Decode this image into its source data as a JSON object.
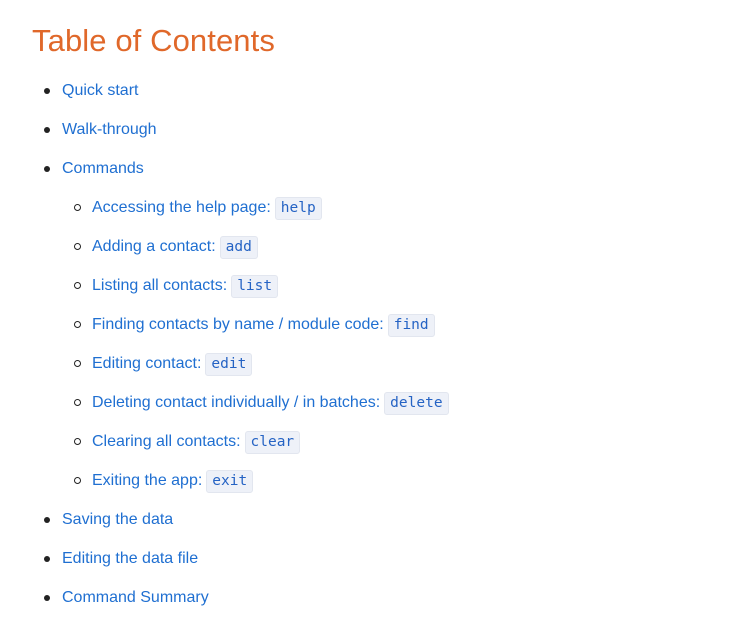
{
  "toc": {
    "title": "Table of Contents",
    "items": [
      {
        "label": "Quick start"
      },
      {
        "label": "Walk-through"
      },
      {
        "label": "Commands",
        "children": [
          {
            "label": "Accessing the help page:",
            "code": "help"
          },
          {
            "label": "Adding a contact:",
            "code": "add"
          },
          {
            "label": "Listing all contacts:",
            "code": "list"
          },
          {
            "label": "Finding contacts by name / module code:",
            "code": "find"
          },
          {
            "label": "Editing contact:",
            "code": "edit"
          },
          {
            "label": "Deleting contact individually / in batches:",
            "code": "delete"
          },
          {
            "label": "Clearing all contacts:",
            "code": "clear"
          },
          {
            "label": "Exiting the app:",
            "code": "exit"
          }
        ]
      },
      {
        "label": "Saving the data"
      },
      {
        "label": "Editing the data file"
      },
      {
        "label": "Command Summary"
      }
    ]
  },
  "colors": {
    "heading": "#e0682a",
    "link": "#1f6fd1",
    "code_background": "#eef1f8"
  }
}
